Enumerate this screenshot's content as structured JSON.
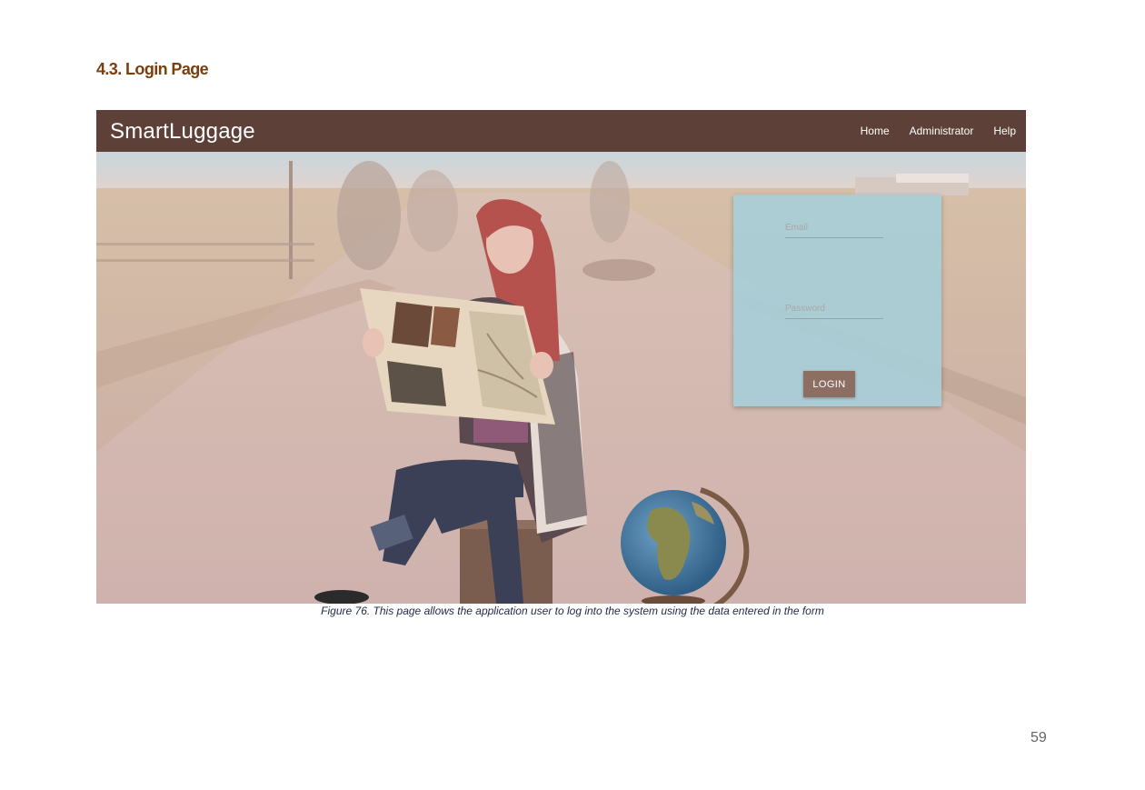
{
  "section_heading": "4.3. Login Page",
  "app": {
    "brand": "SmartLuggage",
    "nav": [
      "Home",
      "Administrator",
      "Help"
    ]
  },
  "login_form": {
    "email_placeholder": "Email",
    "password_placeholder": "Password",
    "login_label": "LOGIN"
  },
  "colors": {
    "navbar": "#5d4037",
    "login_card": "#a8ced6",
    "login_button": "#8d6e63",
    "heading": "#7b3f0e"
  },
  "caption": "Figure 76. This page allows the application user to log into the system using the data entered in the form",
  "page_number": "59"
}
